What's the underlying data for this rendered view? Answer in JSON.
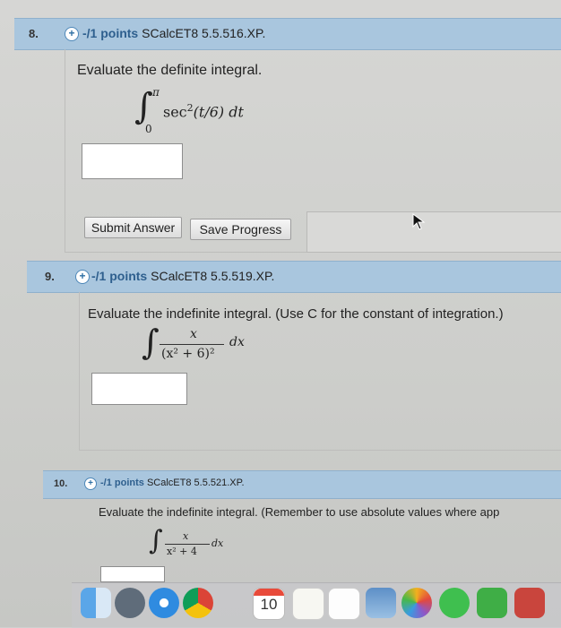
{
  "q8": {
    "number": "8.",
    "points": "-/1 points",
    "code": "SCalcET8 5.5.516.XP.",
    "prompt": "Evaluate the definite integral.",
    "integral": {
      "lower": "0",
      "upper": "π",
      "integrand": "sec",
      "exp": "2",
      "arg": "(t/6)",
      "dvar": "dt"
    },
    "answer_value": "",
    "submit_label": "Submit Answer",
    "save_label": "Save Progress"
  },
  "q9": {
    "number": "9.",
    "points": "-/1 points",
    "code": "SCalcET8 5.5.519.XP.",
    "prompt": "Evaluate the indefinite integral. (Use C for the constant of integration.)",
    "numerator": "x",
    "denominator": "(x² + 6)²",
    "dvar": "dx",
    "answer_value": ""
  },
  "q10": {
    "number": "10.",
    "points": "-/1 points",
    "code": "SCalcET8 5.5.521.XP.",
    "prompt": "Evaluate the indefinite integral. (Remember to use absolute values where app",
    "numerator": "x",
    "denominator": "x² + 4",
    "dvar": "dx"
  },
  "dock": {
    "calendar_day": "10"
  },
  "colors": {
    "question_bar": "#a9c6de",
    "link_blue": "#2e5f8e"
  }
}
